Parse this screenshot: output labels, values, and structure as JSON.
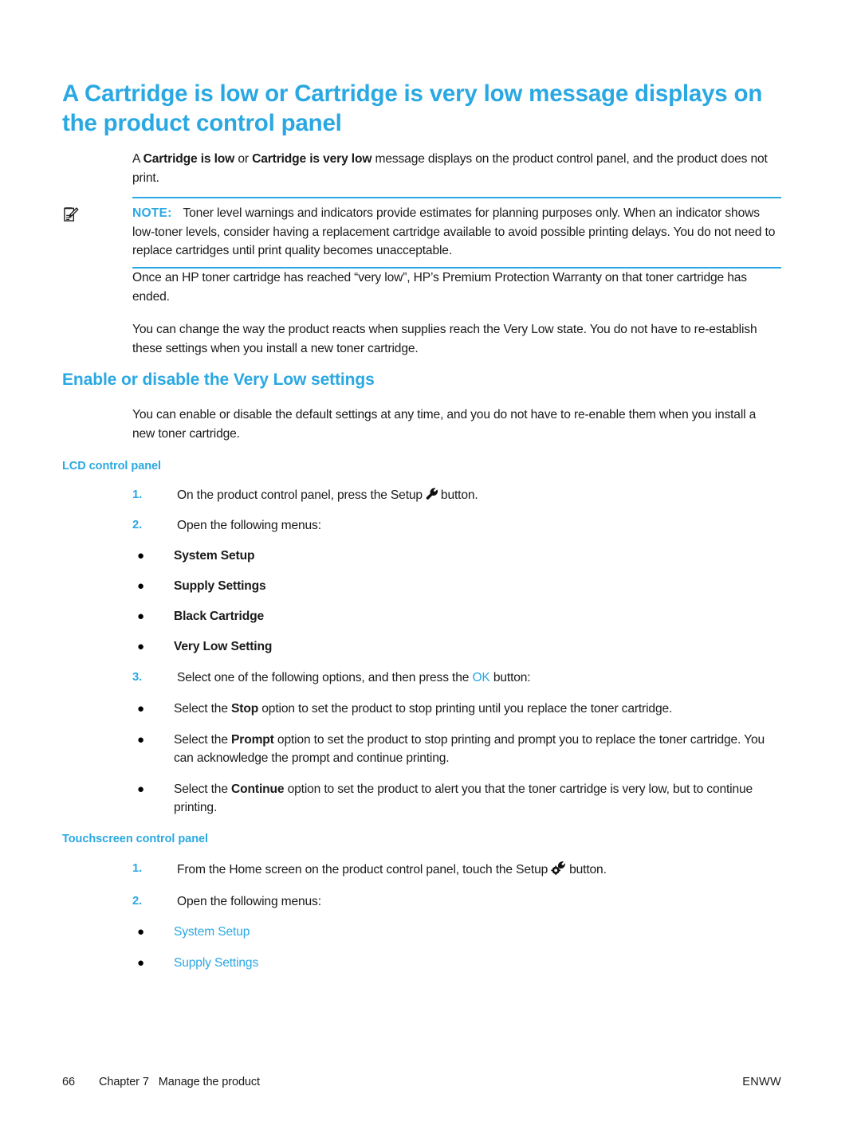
{
  "colors": {
    "accent": "#2AA8E2",
    "text": "#1a1a1a",
    "page_bg": "#ffffff"
  },
  "heading": {
    "title_line1": "A Cartridge is low or Cartridge is very low message displays on",
    "title_line2": "the product control panel"
  },
  "intro": {
    "pre": "A ",
    "bold1": "Cartridge is low",
    "mid": " or ",
    "bold2": "Cartridge is very low",
    "post": " message displays on the product control panel, and the product does not print."
  },
  "note": {
    "icon": "note-pencil-icon",
    "label": "NOTE:",
    "text": "Toner level warnings and indicators provide estimates for planning purposes only. When an indicator shows low-toner levels, consider having a replacement cartridge available to avoid possible printing delays. You do not need to replace cartridges until print quality becomes unacceptable."
  },
  "paragraphs": {
    "warranty": "Once an HP toner cartridge has reached “very low”, HP’s Premium Protection Warranty on that toner cartridge has ended.",
    "very_low_state": "You can change the way the product reacts when supplies reach the Very Low state. You do not have to re-establish these settings when you install a new toner cartridge."
  },
  "section": {
    "subtitle": "Enable or disable the Very Low settings",
    "intro": "You can enable or disable the default settings at any time, and you do not have to re-enable them when you install a new toner cartridge."
  },
  "lcd_panel": {
    "heading": "LCD control panel",
    "step1": {
      "number": "1.",
      "pre": "On the product control panel, press the Setup",
      "icon": "wrench-icon",
      "post": "button."
    },
    "step2": {
      "number": "2.",
      "text": "Open the following menus:"
    },
    "menus": [
      "System Setup",
      "Supply Settings",
      "Black Cartridge",
      "Very Low Setting"
    ],
    "step3": {
      "number": "3.",
      "pre": "Select one of the following options, and then press the ",
      "ok": "OK",
      "post": " button:"
    },
    "options": [
      {
        "pre": "Select the ",
        "bold": "Stop",
        "post": " option to set the product to stop printing until you replace the toner cartridge."
      },
      {
        "pre": "Select the ",
        "bold": "Prompt",
        "post": " option to set the product to stop printing and prompt you to replace the toner cartridge. You can acknowledge the prompt and continue printing."
      },
      {
        "pre": "Select the ",
        "bold": "Continue",
        "post": " option to set the product to alert you that the toner cartridge is very low, but to continue printing."
      }
    ]
  },
  "touchscreen_panel": {
    "heading": "Touchscreen control panel",
    "step1": {
      "number": "1.",
      "pre": "From the Home screen on the product control panel, touch the Setup",
      "icon": "wrench-gear-icon",
      "post": "button."
    },
    "step2": {
      "number": "2.",
      "text": "Open the following menus:"
    },
    "menus": [
      "System Setup",
      "Supply Settings"
    ]
  },
  "footer": {
    "page_number": "66",
    "chapter": "Chapter 7",
    "chapter_title": "Manage the product",
    "locale": "ENWW"
  }
}
